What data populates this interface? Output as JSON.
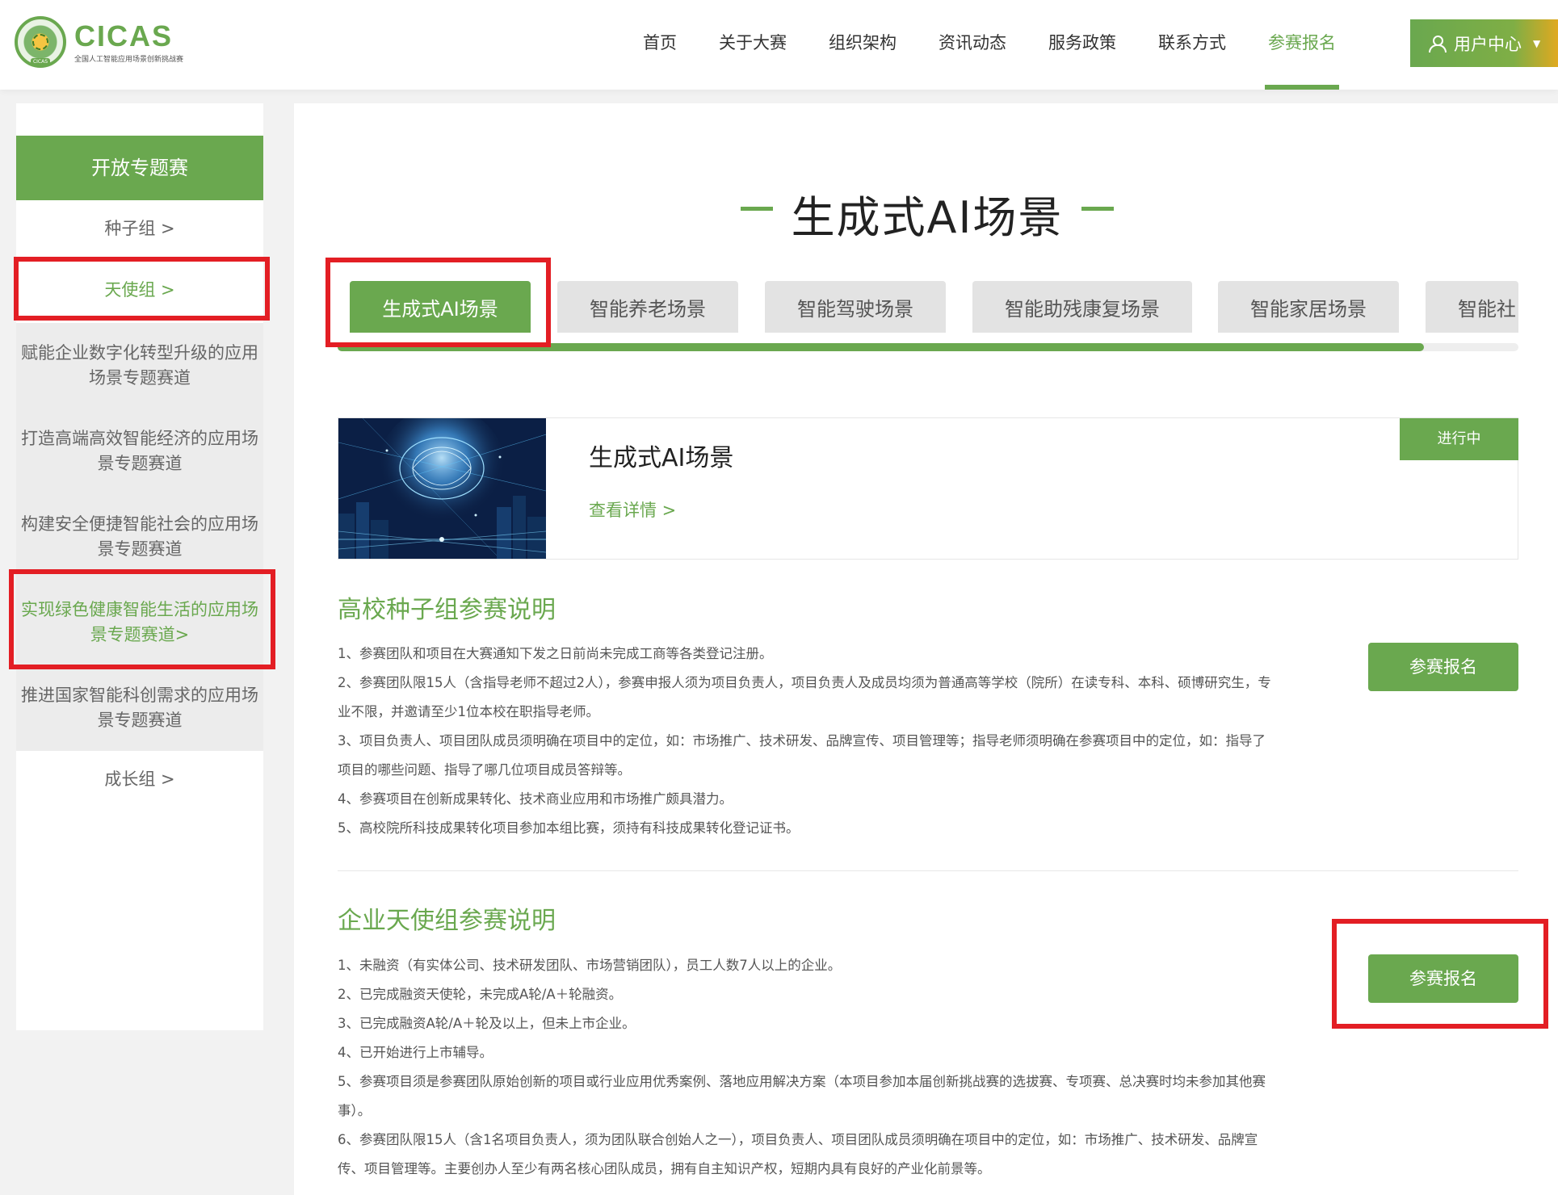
{
  "logo": {
    "title": "CICAS",
    "subtitle": "全国人工智能应用场景创新挑战赛",
    "emblem_tag": "CICAS"
  },
  "nav": {
    "items": [
      "首页",
      "关于大赛",
      "组织架构",
      "资讯动态",
      "服务政策",
      "联系方式",
      "参赛报名"
    ],
    "active_index": 6
  },
  "user_menu": {
    "label": "用户中心",
    "caret": "▼",
    "icon": "user-icon"
  },
  "sidebar": {
    "header": "开放专题赛",
    "items": [
      "种子组 >",
      "天使组 >",
      "赋能企业数字化转型升级的应用场景专题赛道",
      "打造高端高效智能经济的应用场景专题赛道",
      "构建安全便捷智能社会的应用场景专题赛道",
      "实现绿色健康智能生活的应用场景专题赛道>",
      "推进国家智能科创需求的应用场景专题赛道",
      "成长组 >"
    ]
  },
  "page_title": "生成式AI场景",
  "tabs": [
    "生成式AI场景",
    "智能养老场景",
    "智能驾驶场景",
    "智能助残康复场景",
    "智能家居场景",
    "智能社"
  ],
  "tab_scroll_fraction": 0.92,
  "card": {
    "title": "生成式AI场景",
    "link": "查看详情 >",
    "status": "进行中"
  },
  "seed_section": {
    "title": "高校种子组参赛说明",
    "button": "参赛报名",
    "rules": [
      "1、参赛团队和项目在大赛通知下发之日前尚未完成工商等各类登记注册。",
      "2、参赛团队限15人（含指导老师不超过2人），参赛申报人须为项目负责人，项目负责人及成员均须为普通高等学校（院所）在读专科、本科、硕博研究生，专业不限，并邀请至少1位本校在职指导老师。",
      "3、项目负责人、项目团队成员须明确在项目中的定位，如：市场推广、技术研发、品牌宣传、项目管理等；指导老师须明确在参赛项目中的定位，如：指导了项目的哪些问题、指导了哪几位项目成员答辩等。",
      "4、参赛项目在创新成果转化、技术商业应用和市场推广颇具潜力。",
      "5、高校院所科技成果转化项目参加本组比赛，须持有科技成果转化登记证书。"
    ]
  },
  "angel_section": {
    "title": "企业天使组参赛说明",
    "button": "参赛报名",
    "rules": [
      "1、未融资（有实体公司、技术研发团队、市场营销团队），员工人数7人以上的企业。",
      "2、已完成融资天使轮，未完成A轮/A＋轮融资。",
      "3、已完成融资A轮/A＋轮及以上，但未上市企业。",
      "4、已开始进行上市辅导。",
      "5、参赛项目须是参赛团队原始创新的项目或行业应用优秀案例、落地应用解决方案（本项目参加本届创新挑战赛的选拔赛、专项赛、总决赛时均未参加其他赛事）。",
      "6、参赛团队限15人（含1名项目负责人，须为团队联合创始人之一），项目负责人、项目团队成员须明确在项目中的定位，如：市场推广、技术研发、品牌宣传、项目管理等。主要创办人至少有两名核心团队成员，拥有自主知识产权，短期内具有良好的产业化前景等。"
    ]
  },
  "colors": {
    "accent": "#6aa84f",
    "annotation": "#e31e24",
    "sidebar_bg": "#ececec"
  }
}
